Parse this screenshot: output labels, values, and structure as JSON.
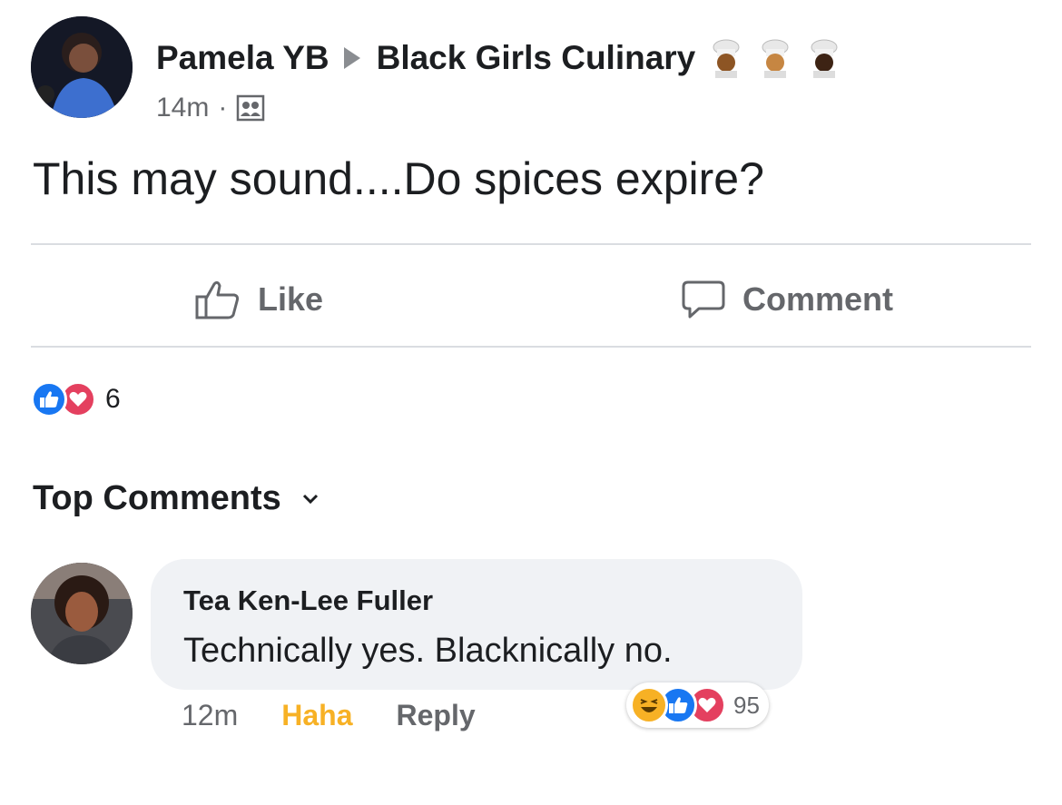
{
  "post": {
    "author": "Pamela YB",
    "group": "Black Girls Culinary",
    "group_emoji": [
      "cook-emoji",
      "cook-emoji",
      "cook-emoji"
    ],
    "time": "14m",
    "separator": "·",
    "audience_icon": "group-audience-icon",
    "text": "This may sound....Do spices expire?"
  },
  "actions": {
    "like_label": "Like",
    "comment_label": "Comment"
  },
  "reactions": {
    "types": [
      "like",
      "love"
    ],
    "count": "6"
  },
  "top_comments_label": "Top Comments",
  "comment": {
    "author": "Tea Ken-Lee Fuller",
    "text": "Technically yes. Blacknically no.",
    "time": "12m",
    "haha_label": "Haha",
    "reply_label": "Reply",
    "reactions": {
      "types": [
        "haha",
        "like",
        "love"
      ],
      "count": "95"
    }
  },
  "colors": {
    "like_blue": "#1877f2",
    "love_red": "#e4405f",
    "haha_yellow": "#f7b125",
    "secondary_text": "#65676b",
    "bubble_bg": "#f0f2f5"
  }
}
